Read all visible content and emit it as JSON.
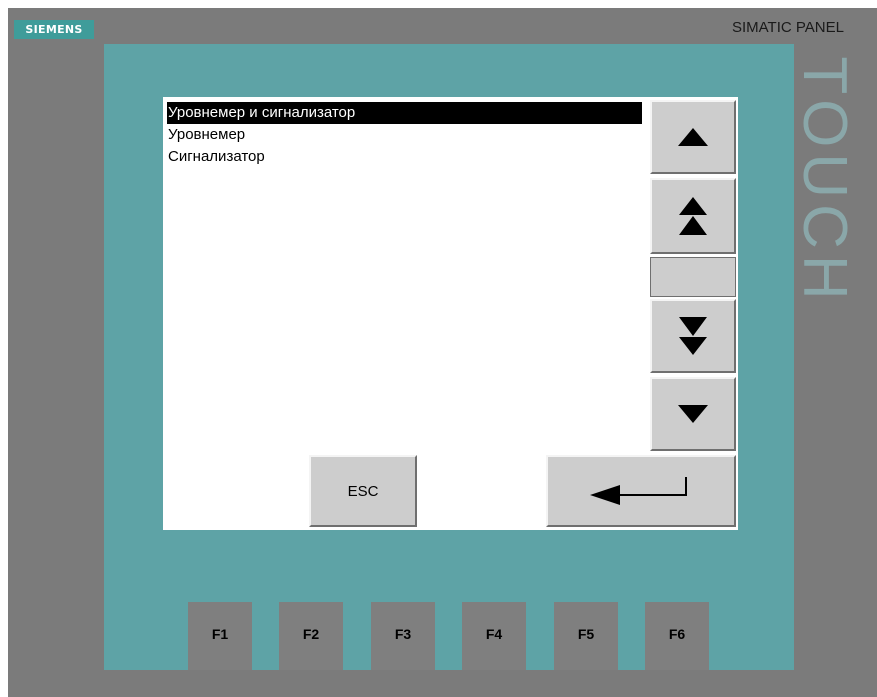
{
  "branding": {
    "manufacturer": "SIEMENS",
    "model": "SIMATIC PANEL",
    "side_label": "TOUCH"
  },
  "list": {
    "items": [
      {
        "label": "Уровнемер и сигнализатор",
        "selected": true
      },
      {
        "label": "Уровнемер",
        "selected": false
      },
      {
        "label": "Сигнализатор",
        "selected": false
      }
    ]
  },
  "buttons": {
    "scroll_up_icon": "triangle-up-icon",
    "page_up_icon": "double-triangle-up-icon",
    "page_down_icon": "double-triangle-down-icon",
    "scroll_down_icon": "triangle-down-icon",
    "esc_label": "ESC",
    "enter_icon": "enter-arrow-icon"
  },
  "function_keys": [
    "F1",
    "F2",
    "F3",
    "F4",
    "F5",
    "F6"
  ],
  "colors": {
    "bezel": "#5ea3a6",
    "frame": "#7b7b7b",
    "screen": "#ffffff",
    "button": "#cdcdcd",
    "logo": "#3f9c9a"
  }
}
